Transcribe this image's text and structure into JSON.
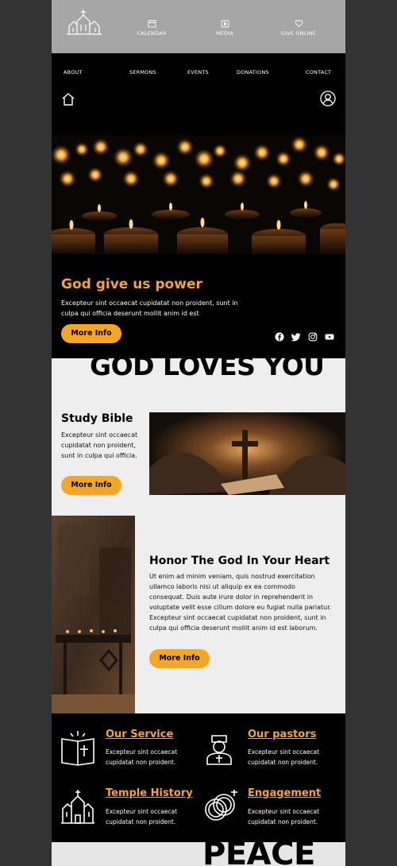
{
  "topbar": {
    "items": [
      {
        "label": "CALENDAR",
        "icon": "calendar-icon"
      },
      {
        "label": "MEDIA",
        "icon": "media-play-icon"
      },
      {
        "label": "GIVE ONLINE",
        "icon": "heart-icon"
      }
    ]
  },
  "nav": {
    "items": [
      "ABOUT",
      "SERMONS",
      "EVENTS",
      "DONATIONS",
      "CONTACT"
    ]
  },
  "hero": {
    "title": "God give us power",
    "text": "Excepteur sint occaecat cupidatat non proident, sunt in culpa qui officia deserunt mollit anim id est",
    "button": "More Info"
  },
  "slogan": "GOD LOVES YOU",
  "study": {
    "title": "Study Bible",
    "text": "Excepteur sint occaecat cupidatat non proident, sunt in culpa qui officia.",
    "button": "More Info"
  },
  "honor": {
    "title": "Honor The God In Your Heart",
    "text": "Ut enim ad minim veniam, quis nostrud exercitation ullamco laboris nisi ut aliquip ex ea commodo consequat. Duis aute irure dolor in reprehenderit in voluptate velit esse cillum dolore eu fugiat nulla pariatur. Excepteur sint occaecat cupidatat non proident, sunt in culpa qui officia deserunt mollit anim id est laborum.",
    "button": "More Info"
  },
  "features": [
    {
      "title": "Our Service",
      "text": "Excepteur sint occaecat cupidatat non proident.",
      "icon": "bible-icon"
    },
    {
      "title": "Our pastors",
      "text": "Excepteur sint occaecat cupidatat non proident.",
      "icon": "pastor-icon"
    },
    {
      "title": "Temple History",
      "text": "Excepteur sint occaecat cupidatat non proident.",
      "icon": "temple-icon"
    },
    {
      "title": "Engagement",
      "text": "Excepteur sint occaecat cupidatat non proident.",
      "icon": "rings-icon"
    }
  ],
  "footer_word": "PEACE",
  "colors": {
    "accent": "#f2a244",
    "button": "#f5a623",
    "topbar": "#a6a6a6",
    "light_bg": "#eeeeee"
  }
}
